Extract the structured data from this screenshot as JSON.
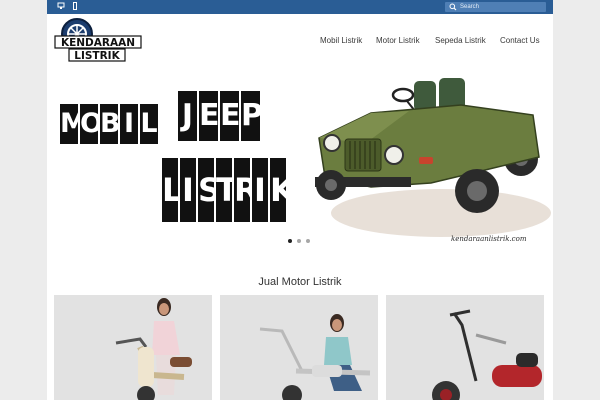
{
  "topbar": {
    "icons": [
      "desktop-icon",
      "mobile-icon"
    ],
    "search_placeholder": "Search"
  },
  "logo": {
    "line1": "KENDARAAN",
    "line2": "LISTRIK"
  },
  "nav": {
    "items": [
      {
        "label": "Mobil Listrik"
      },
      {
        "label": "Motor Listrik"
      },
      {
        "label": "Sepeda Listrik"
      },
      {
        "label": "Contact Us"
      }
    ]
  },
  "hero": {
    "title_words": [
      [
        "M",
        "O",
        "B",
        "I",
        "L"
      ],
      [
        "J",
        "E",
        "E",
        "P"
      ],
      [
        "L",
        "I",
        "S",
        "T",
        "R",
        "I",
        "K"
      ]
    ],
    "watermark": "kendaraanlistrik.com",
    "slide_count": 3,
    "active_slide": 1
  },
  "section": {
    "title": "Jual Motor Listrik"
  },
  "products": [
    {
      "icon": "white-scooter-photo"
    },
    {
      "icon": "silver-chopper-photo"
    },
    {
      "icon": "red-chopper-photo"
    }
  ],
  "colors": {
    "topbar": "#2a5d95",
    "jeep_body": "#6b7d3f",
    "logo_ring": "#1c3d6e"
  }
}
